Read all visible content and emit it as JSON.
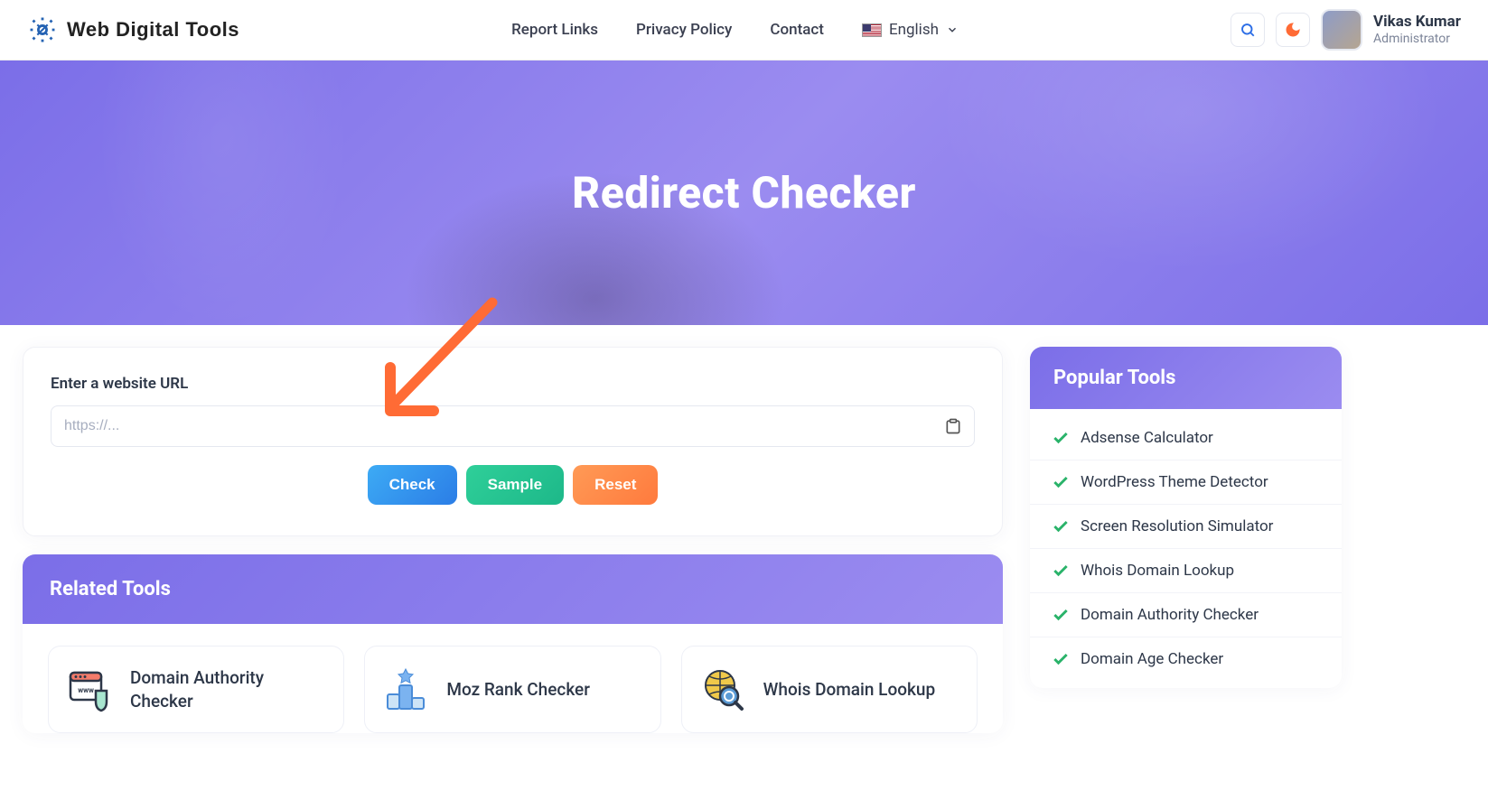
{
  "brand": {
    "name": "Web Digital Tools"
  },
  "nav": {
    "links": [
      "Report Links",
      "Privacy Policy",
      "Contact"
    ],
    "language_label": "English"
  },
  "user": {
    "name": "Vikas Kumar",
    "role": "Administrator"
  },
  "hero": {
    "title": "Redirect Checker"
  },
  "form": {
    "label": "Enter a website URL",
    "placeholder": "https://...",
    "buttons": {
      "check": "Check",
      "sample": "Sample",
      "reset": "Reset"
    }
  },
  "related": {
    "heading": "Related Tools",
    "items": [
      "Domain Authority Checker",
      "Moz Rank Checker",
      "Whois Domain Lookup"
    ]
  },
  "sidebar": {
    "heading": "Popular Tools",
    "items": [
      "Adsense Calculator",
      "WordPress Theme Detector",
      "Screen Resolution Simulator",
      "Whois Domain Lookup",
      "Domain Authority Checker",
      "Domain Age Checker"
    ]
  },
  "colors": {
    "primary_gradient_from": "#7b6ee8",
    "primary_gradient_to": "#9b8cf0",
    "accent_orange": "#ff6b35",
    "success_green": "#2ab36a"
  }
}
